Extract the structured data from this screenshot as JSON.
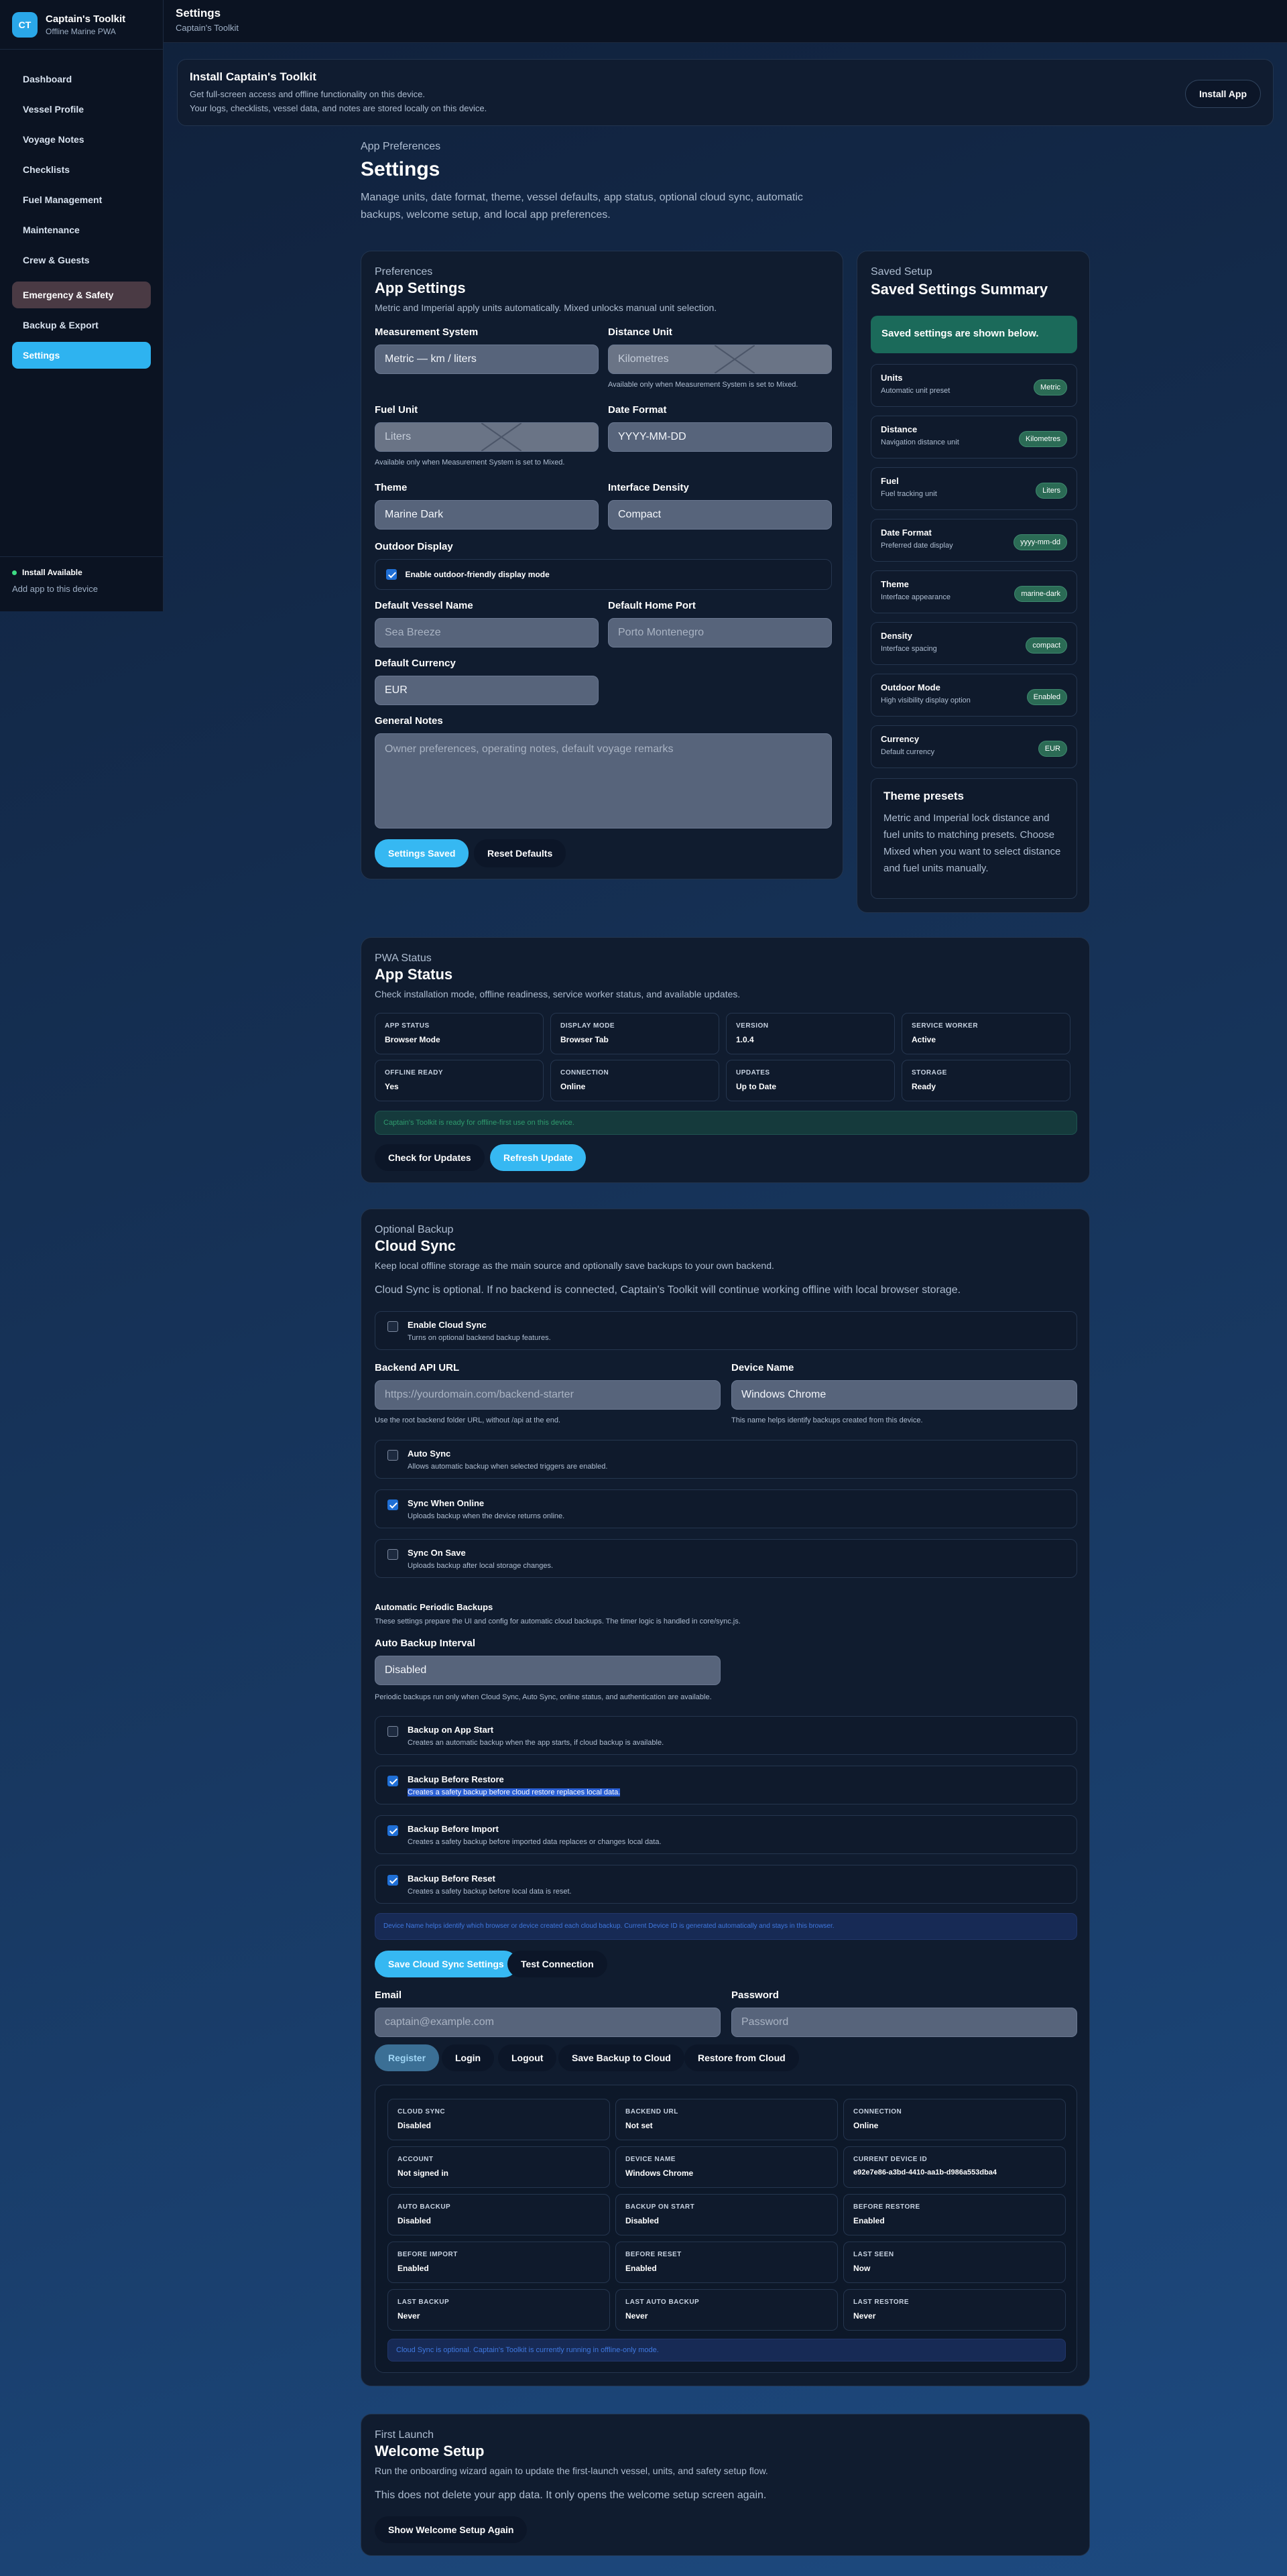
{
  "brand": {
    "logo": "CT",
    "title": "Captain's Toolkit",
    "subtitle": "Offline Marine PWA"
  },
  "nav": [
    "Dashboard",
    "Vessel Profile",
    "Voyage Notes",
    "Checklists",
    "Fuel Management",
    "Maintenance",
    "Crew & Guests",
    "Emergency & Safety",
    "Backup & Export",
    "Settings"
  ],
  "sidebar_footer": {
    "install_available": "Install Available",
    "add_app": "Add app to this device"
  },
  "topbar": {
    "title": "Settings",
    "subtitle": "Captain's Toolkit"
  },
  "install_banner": {
    "title": "Install Captain's Toolkit",
    "line1": "Get full-screen access and offline functionality on this device.",
    "line2": "Your logs, checklists, vessel data, and notes are stored locally on this device.",
    "button": "Install App"
  },
  "page_header": {
    "eyebrow": "App Preferences",
    "title": "Settings",
    "description": "Manage units, date format, theme, vessel defaults, app status, optional cloud sync, automatic backups, welcome setup, and local app preferences."
  },
  "app_settings": {
    "eyebrow": "Preferences",
    "title": "App Settings",
    "description": "Metric and Imperial apply units automatically. Mixed unlocks manual unit selection.",
    "measurement_label": "Measurement System",
    "measurement_value": "Metric — km / liters",
    "distance_label": "Distance Unit",
    "distance_value": "Kilometres",
    "distance_hint": "Available only when Measurement System is set to Mixed.",
    "fuel_label": "Fuel Unit",
    "fuel_value": "Liters",
    "fuel_hint": "Available only when Measurement System is set to Mixed.",
    "date_label": "Date Format",
    "date_value": "YYYY-MM-DD",
    "theme_label": "Theme",
    "theme_value": "Marine Dark",
    "density_label": "Interface Density",
    "density_value": "Compact",
    "outdoor_label": "Outdoor Display",
    "outdoor_check": "Enable outdoor-friendly display mode",
    "vessel_label": "Default Vessel Name",
    "vessel_placeholder": "Sea Breeze",
    "port_label": "Default Home Port",
    "port_placeholder": "Porto Montenegro",
    "currency_label": "Default Currency",
    "currency_value": "EUR",
    "notes_label": "General Notes",
    "notes_placeholder": "Owner preferences, operating notes, default voyage remarks",
    "save_button": "Settings Saved",
    "reset_button": "Reset Defaults"
  },
  "summary": {
    "eyebrow": "Saved Setup",
    "title": "Saved Settings Summary",
    "banner": "Saved settings are shown below.",
    "items": [
      {
        "title": "Units",
        "sub": "Automatic unit preset",
        "value": "Metric"
      },
      {
        "title": "Distance",
        "sub": "Navigation distance unit",
        "value": "Kilometres"
      },
      {
        "title": "Fuel",
        "sub": "Fuel tracking unit",
        "value": "Liters"
      },
      {
        "title": "Date Format",
        "sub": "Preferred date display",
        "value": "yyyy-mm-dd"
      },
      {
        "title": "Theme",
        "sub": "Interface appearance",
        "value": "marine-dark"
      },
      {
        "title": "Density",
        "sub": "Interface spacing",
        "value": "compact"
      },
      {
        "title": "Outdoor Mode",
        "sub": "High visibility display option",
        "value": "Enabled"
      },
      {
        "title": "Currency",
        "sub": "Default currency",
        "value": "EUR"
      }
    ],
    "presets_title": "Theme presets",
    "presets_text": "Metric and Imperial lock distance and fuel units to matching presets. Choose Mixed when you want to select distance and fuel units manually."
  },
  "pwa": {
    "eyebrow": "PWA Status",
    "title": "App Status",
    "description": "Check installation mode, offline readiness, service worker status, and available updates.",
    "stats": [
      {
        "k": "APP STATUS",
        "v": "Browser Mode"
      },
      {
        "k": "DISPLAY MODE",
        "v": "Browser Tab"
      },
      {
        "k": "VERSION",
        "v": "1.0.4"
      },
      {
        "k": "SERVICE WORKER",
        "v": "Active"
      },
      {
        "k": "OFFLINE READY",
        "v": "Yes"
      },
      {
        "k": "CONNECTION",
        "v": "Online"
      },
      {
        "k": "UPDATES",
        "v": "Up to Date"
      },
      {
        "k": "STORAGE",
        "v": "Ready"
      }
    ],
    "ready_message": "Captain's Toolkit is ready for offline-first use on this device.",
    "check_button": "Check for Updates",
    "refresh_button": "Refresh Update"
  },
  "cloud": {
    "eyebrow": "Optional Backup",
    "title": "Cloud Sync",
    "description": "Keep local offline storage as the main source and optionally save backups to your own backend.",
    "note": "Cloud Sync is optional. If no backend is connected, Captain's Toolkit will continue working offline with local browser storage.",
    "enable_title": "Enable Cloud Sync",
    "enable_sub": "Turns on optional backend backup features.",
    "api_label": "Backend API URL",
    "api_placeholder": "https://yourdomain.com/backend-starter",
    "api_hint": "Use the root backend folder URL, without /api at the end.",
    "device_label": "Device Name",
    "device_value": "Windows Chrome",
    "device_hint": "This name helps identify backups created from this device.",
    "options": [
      {
        "title": "Auto Sync",
        "sub": "Allows automatic backup when selected triggers are enabled."
      },
      {
        "title": "Sync When Online",
        "sub": "Uploads backup when the device returns online."
      },
      {
        "title": "Sync On Save",
        "sub": "Uploads backup after local storage changes."
      }
    ],
    "periodic_title": "Automatic Periodic Backups",
    "periodic_desc": "These settings prepare the UI and config for automatic cloud backups. The timer logic is handled in core/sync.js.",
    "interval_label": "Auto Backup Interval",
    "interval_value": "Disabled",
    "interval_hint": "Periodic backups run only when Cloud Sync, Auto Sync, online status, and authentication are available.",
    "backup_options": [
      {
        "title": "Backup on App Start",
        "sub": "Creates an automatic backup when the app starts, if cloud backup is available."
      },
      {
        "title": "Backup Before Restore",
        "sub": "Creates a safety backup before cloud restore replaces local data."
      },
      {
        "title": "Backup Before Import",
        "sub": "Creates a safety backup before imported data replaces or changes local data."
      },
      {
        "title": "Backup Before Reset",
        "sub": "Creates a safety backup before local data is reset."
      }
    ],
    "device_notice": "Device Name helps identify which browser or device created each cloud backup. Current Device ID is generated automatically and stays in this browser.",
    "save_button": "Save Cloud Sync Settings",
    "test_button": "Test Connection",
    "email_label": "Email",
    "email_placeholder": "captain@example.com",
    "password_label": "Password",
    "password_placeholder": "Password",
    "actions": [
      "Register",
      "Login",
      "Logout",
      "Save Backup to Cloud",
      "Restore from Cloud"
    ],
    "stats": [
      {
        "k": "CLOUD SYNC",
        "v": "Disabled"
      },
      {
        "k": "BACKEND URL",
        "v": "Not set"
      },
      {
        "k": "CONNECTION",
        "v": "Online"
      },
      {
        "k": "ACCOUNT",
        "v": "Not signed in"
      },
      {
        "k": "DEVICE NAME",
        "v": "Windows Chrome"
      },
      {
        "k": "CURRENT DEVICE ID",
        "v": "e92e7e86-a3bd-4410-aa1b-d986a553dba4"
      },
      {
        "k": "AUTO BACKUP",
        "v": "Disabled"
      },
      {
        "k": "BACKUP ON START",
        "v": "Disabled"
      },
      {
        "k": "BEFORE RESTORE",
        "v": "Enabled"
      },
      {
        "k": "BEFORE IMPORT",
        "v": "Enabled"
      },
      {
        "k": "BEFORE RESET",
        "v": "Enabled"
      },
      {
        "k": "LAST SEEN",
        "v": "Now"
      },
      {
        "k": "LAST BACKUP",
        "v": "Never"
      },
      {
        "k": "LAST AUTO BACKUP",
        "v": "Never"
      },
      {
        "k": "LAST RESTORE",
        "v": "Never"
      }
    ],
    "offline_notice": "Cloud Sync is optional. Captain's Toolkit is currently running in offline-only mode."
  },
  "welcome": {
    "eyebrow": "First Launch",
    "title": "Welcome Setup",
    "description": "Run the onboarding wizard again to update the first-launch vessel, units, and safety setup flow.",
    "note": "This does not delete your app data. It only opens the welcome setup screen again.",
    "button": "Show Welcome Setup Again"
  },
  "colors": {
    "accent": "#36b8f2",
    "success": "#2b6b55",
    "background": "#10203a"
  }
}
